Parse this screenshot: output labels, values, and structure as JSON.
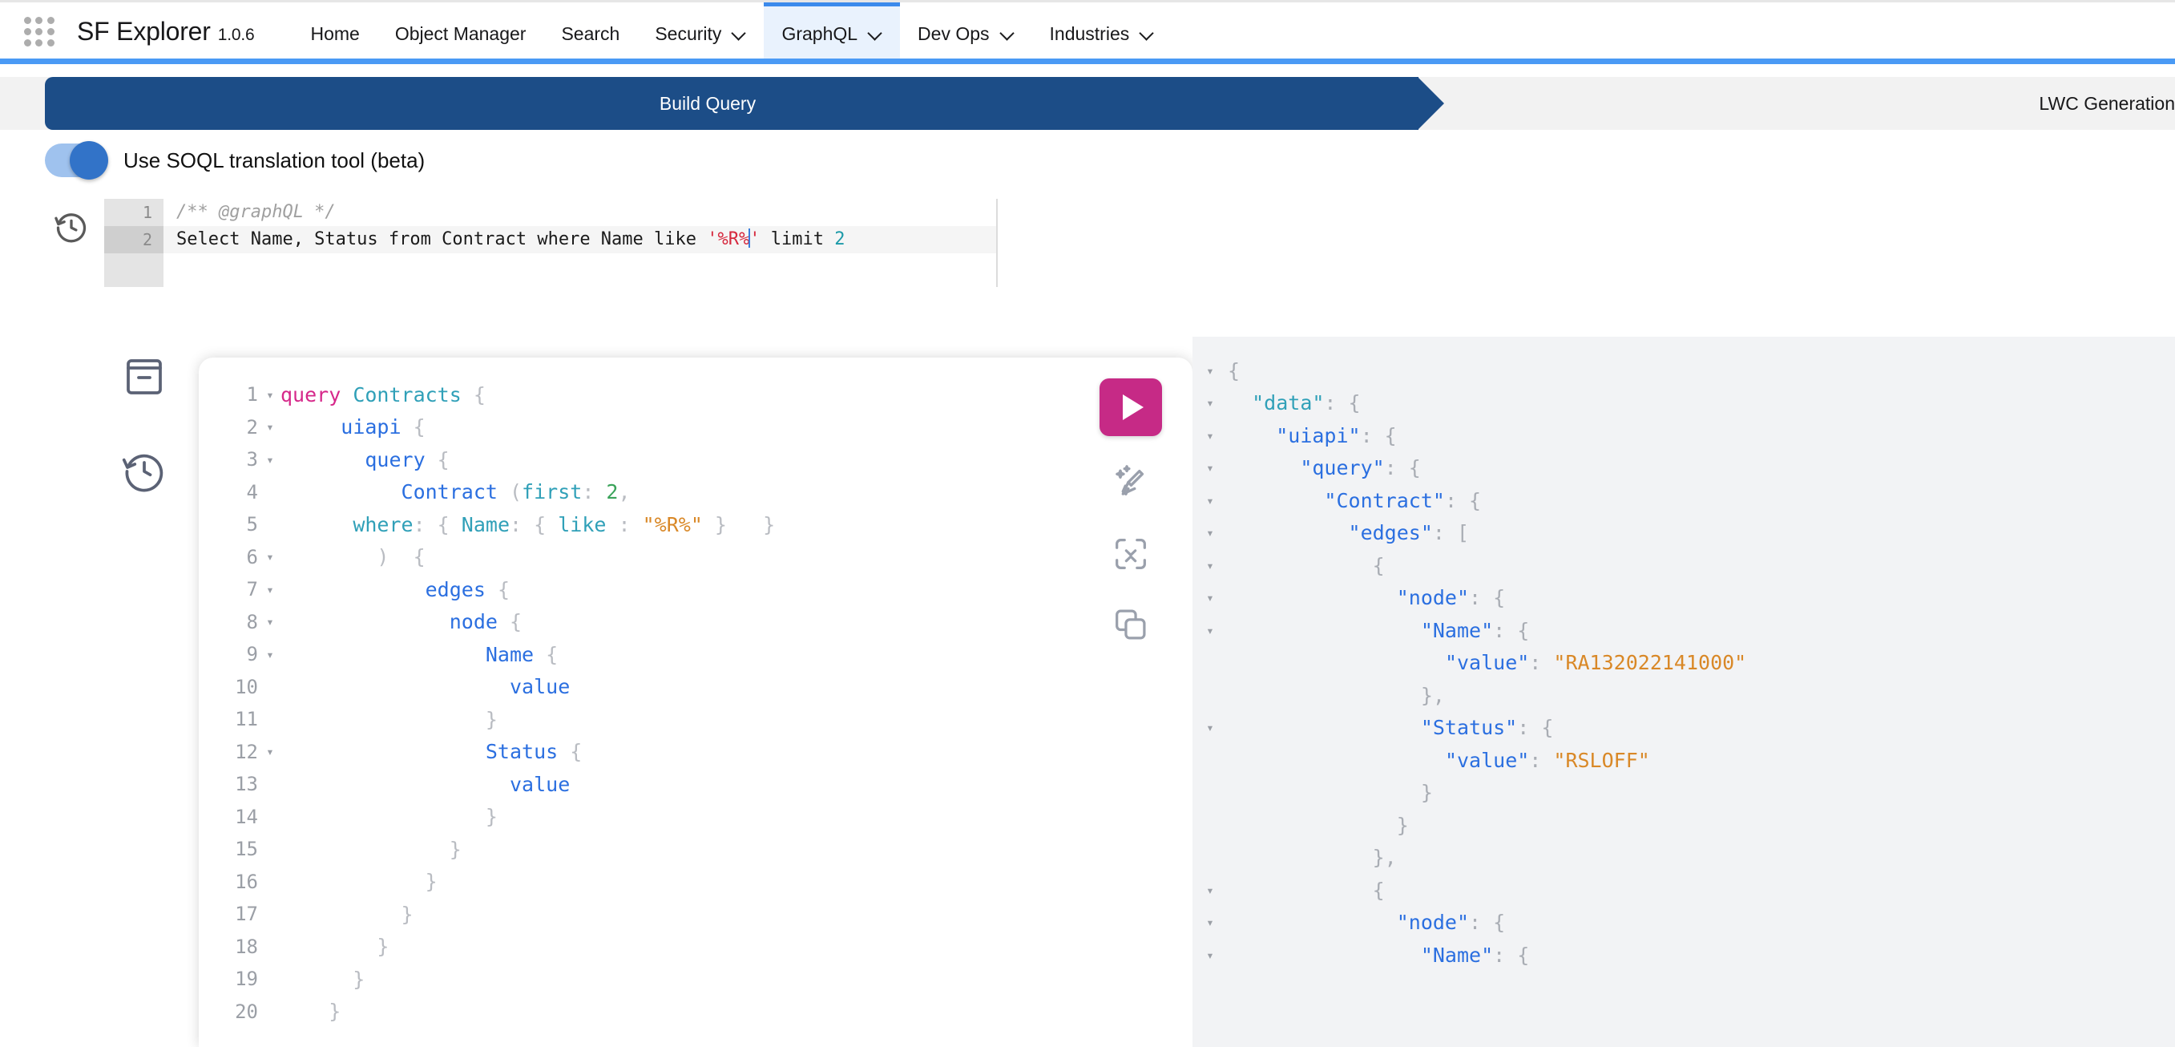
{
  "nav": {
    "app_launcher_icon": "app-launcher-grid-icon",
    "brand": "SF Explorer",
    "version": "1.0.6",
    "items": [
      {
        "label": "Home",
        "has_chevron": false,
        "active": false
      },
      {
        "label": "Object Manager",
        "has_chevron": false,
        "active": false
      },
      {
        "label": "Search",
        "has_chevron": false,
        "active": false
      },
      {
        "label": "Security",
        "has_chevron": true,
        "active": false
      },
      {
        "label": "GraphQL",
        "has_chevron": true,
        "active": true
      },
      {
        "label": "Dev Ops",
        "has_chevron": true,
        "active": false
      },
      {
        "label": "Industries",
        "has_chevron": true,
        "active": false
      }
    ]
  },
  "steps": {
    "active_label": "Build Query",
    "next_label": "LWC Generation"
  },
  "soql_toggle": {
    "label": "Use SOQL translation tool (beta)",
    "state": "on"
  },
  "soql_editor": {
    "history_icon": "history-clock-icon",
    "lines": [
      {
        "number": "1",
        "current": false,
        "segments": [
          {
            "cls": "sq-comment",
            "text": "/** @graphQL */"
          }
        ]
      },
      {
        "number": "2",
        "current": true,
        "segments": [
          {
            "cls": "sq-plain",
            "text": "Select Name, Status from Contract where Name like "
          },
          {
            "cls": "sq-str",
            "text": "'%R%"
          },
          {
            "cls": "caret",
            "text": ""
          },
          {
            "cls": "sq-str",
            "text": "'"
          },
          {
            "cls": "sq-plain",
            "text": " limit "
          },
          {
            "cls": "sq-num",
            "text": "2"
          }
        ]
      }
    ]
  },
  "left_rail": [
    {
      "icon": "docs-book-icon",
      "name": "docs-button"
    },
    {
      "icon": "history-clock-icon",
      "name": "history-button"
    }
  ],
  "query_editor": {
    "lines": [
      {
        "number": "1",
        "fold": "▾",
        "segments": [
          {
            "cls": "t-kw",
            "text": "query "
          },
          {
            "cls": "t-name",
            "text": "Contracts"
          },
          {
            "cls": "t-punc",
            "text": " {"
          }
        ]
      },
      {
        "number": "2",
        "fold": "▾",
        "segments": [
          {
            "cls": "t-punc",
            "text": "     "
          },
          {
            "cls": "t-fld",
            "text": "uiapi"
          },
          {
            "cls": "t-punc",
            "text": " {"
          }
        ]
      },
      {
        "number": "3",
        "fold": "▾",
        "segments": [
          {
            "cls": "t-punc",
            "text": "       "
          },
          {
            "cls": "t-fld",
            "text": "query"
          },
          {
            "cls": "t-punc",
            "text": " {"
          }
        ]
      },
      {
        "number": "4",
        "fold": "",
        "segments": [
          {
            "cls": "t-punc",
            "text": "          "
          },
          {
            "cls": "t-fld",
            "text": "Contract"
          },
          {
            "cls": "t-punc",
            "text": " ("
          },
          {
            "cls": "t-arg",
            "text": "first"
          },
          {
            "cls": "t-punc",
            "text": ": "
          },
          {
            "cls": "t-num",
            "text": "2"
          },
          {
            "cls": "t-punc",
            "text": ","
          }
        ]
      },
      {
        "number": "5",
        "fold": "",
        "segments": [
          {
            "cls": "t-punc",
            "text": "      "
          },
          {
            "cls": "t-arg",
            "text": "where"
          },
          {
            "cls": "t-punc",
            "text": ": { "
          },
          {
            "cls": "t-arg",
            "text": "Name"
          },
          {
            "cls": "t-punc",
            "text": ": { "
          },
          {
            "cls": "t-arg",
            "text": "like"
          },
          {
            "cls": "t-punc",
            "text": " : "
          },
          {
            "cls": "t-str",
            "text": "\"%R%\""
          },
          {
            "cls": "t-punc",
            "text": " }   }"
          }
        ]
      },
      {
        "number": "6",
        "fold": "▾",
        "segments": [
          {
            "cls": "t-punc",
            "text": "        )  {"
          }
        ]
      },
      {
        "number": "7",
        "fold": "▾",
        "segments": [
          {
            "cls": "t-punc",
            "text": "            "
          },
          {
            "cls": "t-fld",
            "text": "edges"
          },
          {
            "cls": "t-punc",
            "text": " {"
          }
        ]
      },
      {
        "number": "8",
        "fold": "▾",
        "segments": [
          {
            "cls": "t-punc",
            "text": "              "
          },
          {
            "cls": "t-fld",
            "text": "node"
          },
          {
            "cls": "t-punc",
            "text": " {"
          }
        ]
      },
      {
        "number": "9",
        "fold": "▾",
        "segments": [
          {
            "cls": "t-punc",
            "text": "                 "
          },
          {
            "cls": "t-fld",
            "text": "Name"
          },
          {
            "cls": "t-punc",
            "text": " {"
          }
        ]
      },
      {
        "number": "10",
        "fold": "",
        "segments": [
          {
            "cls": "t-punc",
            "text": "                   "
          },
          {
            "cls": "t-fld",
            "text": "value"
          }
        ]
      },
      {
        "number": "11",
        "fold": "",
        "segments": [
          {
            "cls": "t-punc",
            "text": "                 }"
          }
        ]
      },
      {
        "number": "12",
        "fold": "▾",
        "segments": [
          {
            "cls": "t-punc",
            "text": "                 "
          },
          {
            "cls": "t-fld",
            "text": "Status"
          },
          {
            "cls": "t-punc",
            "text": " {"
          }
        ]
      },
      {
        "number": "13",
        "fold": "",
        "segments": [
          {
            "cls": "t-punc",
            "text": "                   "
          },
          {
            "cls": "t-fld",
            "text": "value"
          }
        ]
      },
      {
        "number": "14",
        "fold": "",
        "segments": [
          {
            "cls": "t-punc",
            "text": "                 }"
          }
        ]
      },
      {
        "number": "15",
        "fold": "",
        "segments": [
          {
            "cls": "t-punc",
            "text": "              }"
          }
        ]
      },
      {
        "number": "16",
        "fold": "",
        "segments": [
          {
            "cls": "t-punc",
            "text": "            }"
          }
        ]
      },
      {
        "number": "17",
        "fold": "",
        "segments": [
          {
            "cls": "t-punc",
            "text": "          }"
          }
        ]
      },
      {
        "number": "18",
        "fold": "",
        "segments": [
          {
            "cls": "t-punc",
            "text": "        }"
          }
        ]
      },
      {
        "number": "19",
        "fold": "",
        "segments": [
          {
            "cls": "t-punc",
            "text": "      }"
          }
        ]
      },
      {
        "number": "20",
        "fold": "",
        "segments": [
          {
            "cls": "t-punc",
            "text": "    }"
          }
        ]
      }
    ],
    "tools": [
      {
        "name": "execute-query-button",
        "icon": "play-triangle-icon",
        "label": ""
      },
      {
        "name": "prettify-query-button",
        "icon": "magic-broom-icon",
        "label": ""
      },
      {
        "name": "collapse-all-button",
        "icon": "collapse-chevrons-icon",
        "label": ""
      },
      {
        "name": "copy-query-button",
        "icon": "copy-icon",
        "label": ""
      }
    ]
  },
  "result_viewer": {
    "lines": [
      {
        "fold": "▾",
        "segments": [
          {
            "cls": "j-punc",
            "text": "{"
          }
        ]
      },
      {
        "fold": "▾",
        "segments": [
          {
            "cls": "j-punc",
            "text": "  "
          },
          {
            "cls": "j-key2",
            "text": "\"data\""
          },
          {
            "cls": "j-punc",
            "text": ": {"
          }
        ]
      },
      {
        "fold": "▾",
        "segments": [
          {
            "cls": "j-punc",
            "text": "    "
          },
          {
            "cls": "j-key",
            "text": "\"uiapi\""
          },
          {
            "cls": "j-punc",
            "text": ": {"
          }
        ]
      },
      {
        "fold": "▾",
        "segments": [
          {
            "cls": "j-punc",
            "text": "      "
          },
          {
            "cls": "j-key",
            "text": "\"query\""
          },
          {
            "cls": "j-punc",
            "text": ": {"
          }
        ]
      },
      {
        "fold": "▾",
        "segments": [
          {
            "cls": "j-punc",
            "text": "        "
          },
          {
            "cls": "j-key",
            "text": "\"Contract\""
          },
          {
            "cls": "j-punc",
            "text": ": {"
          }
        ]
      },
      {
        "fold": "▾",
        "segments": [
          {
            "cls": "j-punc",
            "text": "          "
          },
          {
            "cls": "j-key",
            "text": "\"edges\""
          },
          {
            "cls": "j-punc",
            "text": ": ["
          }
        ]
      },
      {
        "fold": "▾",
        "segments": [
          {
            "cls": "j-punc",
            "text": "            {"
          }
        ]
      },
      {
        "fold": "▾",
        "segments": [
          {
            "cls": "j-punc",
            "text": "              "
          },
          {
            "cls": "j-key",
            "text": "\"node\""
          },
          {
            "cls": "j-punc",
            "text": ": {"
          }
        ]
      },
      {
        "fold": "▾",
        "segments": [
          {
            "cls": "j-punc",
            "text": "                "
          },
          {
            "cls": "j-key",
            "text": "\"Name\""
          },
          {
            "cls": "j-punc",
            "text": ": {"
          }
        ]
      },
      {
        "fold": "",
        "segments": [
          {
            "cls": "j-punc",
            "text": "                  "
          },
          {
            "cls": "j-key",
            "text": "\"value\""
          },
          {
            "cls": "j-punc",
            "text": ": "
          },
          {
            "cls": "j-str",
            "text": "\"RA132022141000\""
          }
        ]
      },
      {
        "fold": "",
        "segments": [
          {
            "cls": "j-punc",
            "text": "                },"
          }
        ]
      },
      {
        "fold": "▾",
        "segments": [
          {
            "cls": "j-punc",
            "text": "                "
          },
          {
            "cls": "j-key",
            "text": "\"Status\""
          },
          {
            "cls": "j-punc",
            "text": ": {"
          }
        ]
      },
      {
        "fold": "",
        "segments": [
          {
            "cls": "j-punc",
            "text": "                  "
          },
          {
            "cls": "j-key",
            "text": "\"value\""
          },
          {
            "cls": "j-punc",
            "text": ": "
          },
          {
            "cls": "j-str",
            "text": "\"RSLOFF\""
          }
        ]
      },
      {
        "fold": "",
        "segments": [
          {
            "cls": "j-punc",
            "text": "                }"
          }
        ]
      },
      {
        "fold": "",
        "segments": [
          {
            "cls": "j-punc",
            "text": "              }"
          }
        ]
      },
      {
        "fold": "",
        "segments": [
          {
            "cls": "j-punc",
            "text": "            },"
          }
        ]
      },
      {
        "fold": "▾",
        "segments": [
          {
            "cls": "j-punc",
            "text": "            {"
          }
        ]
      },
      {
        "fold": "▾",
        "segments": [
          {
            "cls": "j-punc",
            "text": "              "
          },
          {
            "cls": "j-key",
            "text": "\"node\""
          },
          {
            "cls": "j-punc",
            "text": ": {"
          }
        ]
      },
      {
        "fold": "▾",
        "segments": [
          {
            "cls": "j-punc",
            "text": "                "
          },
          {
            "cls": "j-key",
            "text": "\"Name\""
          },
          {
            "cls": "j-punc",
            "text": ": {"
          }
        ]
      }
    ]
  },
  "colors": {
    "nav_underline": "#4a9af5",
    "active_tab_bg": "#e9f2fd",
    "step_active_bg": "#1c4d87",
    "run_button": "#c62a86",
    "toggle_on_knob": "#3273c8",
    "result_bg": "#f2f3f5"
  }
}
